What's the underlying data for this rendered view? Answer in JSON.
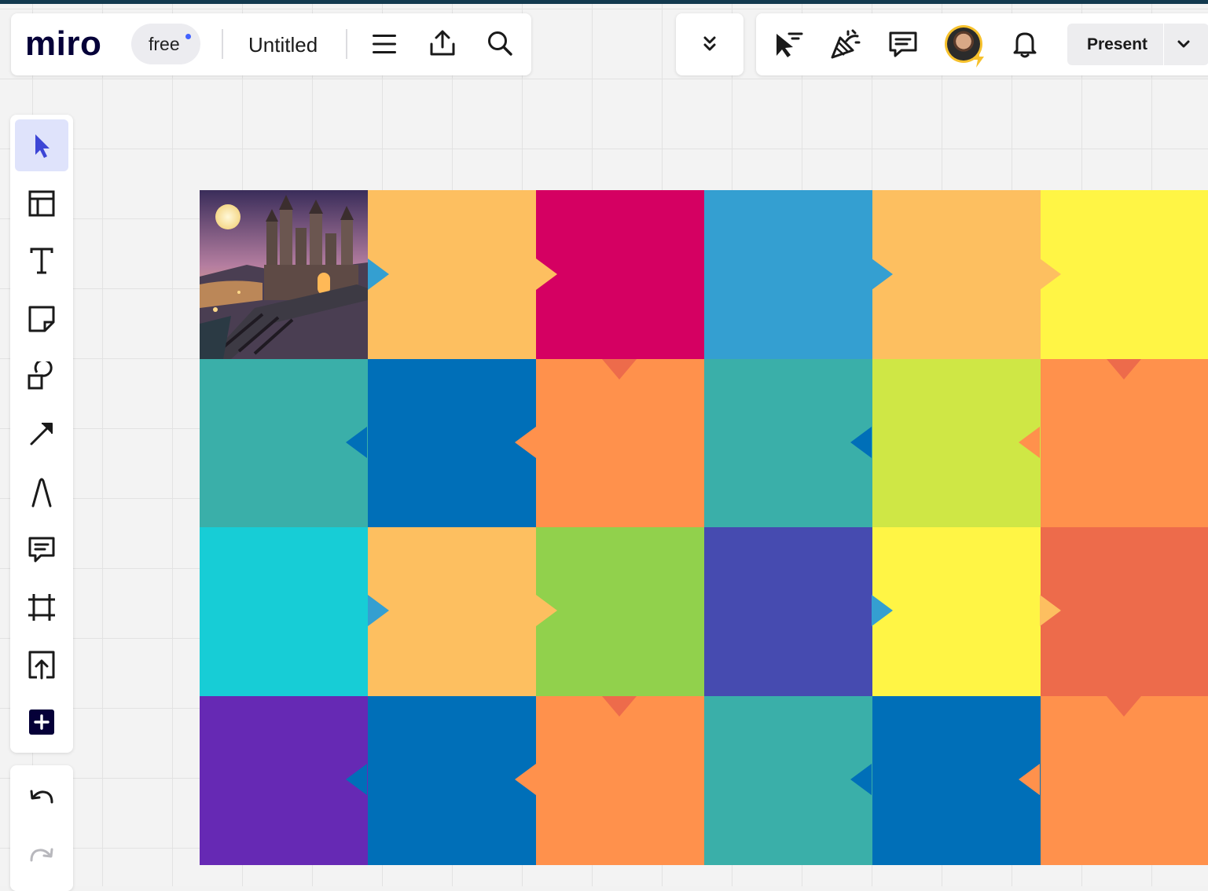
{
  "app": {
    "logo_text": "miro",
    "plan_label": "free",
    "board_title": "Untitled"
  },
  "header_left": {
    "icons": [
      "hamburger-menu-icon",
      "export-upload-icon",
      "search-icon"
    ]
  },
  "header_mid": {
    "icons": [
      "double-chevron-down-icon"
    ]
  },
  "header_right": {
    "icons": [
      "cursor-flag-icon",
      "celebrate-popper-icon",
      "comment-icon",
      "avatar",
      "bell-icon"
    ],
    "present_label": "Present"
  },
  "toolbar": {
    "tools": [
      "select",
      "templates",
      "text",
      "sticky-note",
      "shapes",
      "connection-line",
      "pen",
      "comment",
      "frame",
      "upload",
      "more"
    ],
    "active_tool": "select"
  },
  "undo_redo": [
    "undo",
    "redo"
  ],
  "board": {
    "image_tile": "castle-image",
    "grid_rows": [
      [
        "image",
        "#fdbf60",
        "#d50062",
        "#349fd1",
        "#fdbf60",
        "#fff545"
      ],
      [
        "#3aafa9",
        "#006fb8",
        "#ff914c",
        "#3aafa9",
        "#cfe745",
        "#ff914c"
      ],
      [
        "#17cdd6",
        "#fdbf60",
        "#91d14c",
        "#464bb0",
        "#fff545",
        "#ed6b4b"
      ],
      [
        "#6629b4",
        "#006fb8",
        "#ff914c",
        "#3aafa9",
        "#006fb8",
        "#ff914c"
      ]
    ]
  },
  "colors": {
    "accent": "#4262ff",
    "top_strip": "#12394e",
    "active_tool_bg": "#dfe3fb",
    "ink": "#050038"
  }
}
